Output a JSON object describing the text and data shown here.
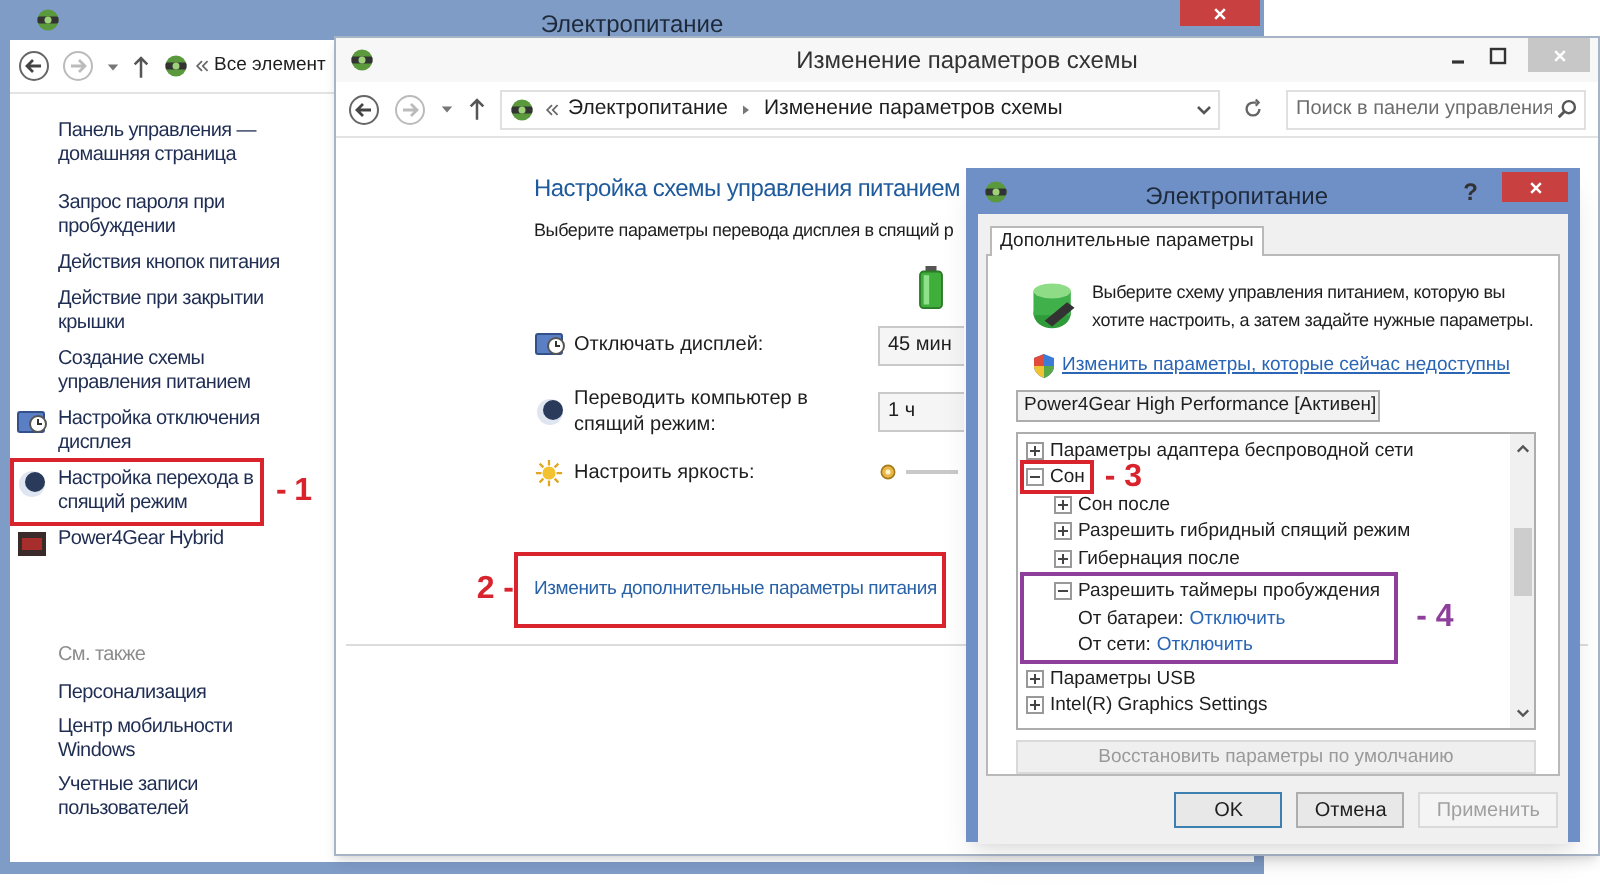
{
  "back_window": {
    "title": "Электропитание",
    "address": "Все элемент",
    "sidebar": {
      "home_link": "Панель управления — домашняя страница",
      "items": [
        {
          "label": "Запрос пароля при пробуждении",
          "kind": "link"
        },
        {
          "label": "Действия кнопок питания",
          "kind": "link"
        },
        {
          "label": "Действие при закрытии крышки",
          "kind": "link"
        },
        {
          "label": "Создание схемы управления питанием",
          "kind": "link"
        },
        {
          "label": "Настройка отключения дисплея",
          "kind": "display"
        },
        {
          "label": "Настройка перехода в спящий режим",
          "kind": "sleep",
          "marker": {
            "label": "- 1",
            "color": "#d9232d",
            "label_before": false
          }
        },
        {
          "label": "Power4Gear Hybrid",
          "kind": "plan"
        }
      ],
      "see_also_heading": "См. также",
      "see_also": [
        "Персонализация",
        "Центр мобильности Windows",
        "Учетные записи пользователей"
      ]
    }
  },
  "scheme_window": {
    "title": "Изменение параметров схемы",
    "breadcrumb": [
      "Электропитание",
      "Изменение параметров схемы"
    ],
    "search": {
      "placeholder": "Поиск в панели управления"
    },
    "heading": "Настройка схемы управления питанием",
    "subtitle": "Выберите параметры перевода дисплея в спящий р",
    "settings": [
      {
        "label": "Отключать дисплей:",
        "kind": "display",
        "value": "45 мин"
      },
      {
        "label": "Переводить компьютер в спящий режим:",
        "kind": "sleep",
        "value": "1 ч"
      },
      {
        "label": "Настроить яркость:",
        "kind": "brightness"
      }
    ],
    "advanced_link": {
      "label": "Изменить дополнительные параметры питания",
      "marker": {
        "label": "2 -",
        "color": "#d9232d",
        "label_before": true
      }
    }
  },
  "dialog": {
    "title": "Электропитание",
    "help": "?",
    "tabs": [
      {
        "label": "Дополнительные параметры",
        "selected": true
      }
    ],
    "intro": "Выберите схему управления питанием, которую вы хотите настроить, а затем задайте нужные параметры.",
    "admin_link": "Изменить параметры, которые сейчас недоступны",
    "plan_select": "Power4Gear High Performance [Активен]",
    "tree": [
      {
        "label": "Параметры адаптера беспроводной сети",
        "kind": "group",
        "expanded": false
      },
      {
        "label": "Сон",
        "kind": "group",
        "expanded": true,
        "marker": {
          "label": "- 3",
          "color": "#d9232d",
          "label_before": false,
          "frames_children": false
        },
        "children": [
          {
            "label": "Сон после",
            "kind": "group",
            "expanded": false
          },
          {
            "label": "Разрешить гибридный спящий режим",
            "kind": "group",
            "expanded": false
          },
          {
            "label": "Гибернация после",
            "kind": "group",
            "expanded": false
          },
          {
            "label": "Разрешить таймеры пробуждения",
            "kind": "group",
            "expanded": true,
            "marker": {
              "label": "- 4",
              "color": "#8e3f9c",
              "label_before": false,
              "frames_children": true
            },
            "children": [
              {
                "label": "От батареи:",
                "kind": "setting",
                "value": "Отключить"
              },
              {
                "label": "От сети:",
                "kind": "setting",
                "value": "Отключить"
              }
            ]
          }
        ]
      },
      {
        "label": "Параметры USB",
        "kind": "group",
        "expanded": false
      },
      {
        "label": "Intel(R) Graphics Settings",
        "kind": "group",
        "expanded": false
      }
    ],
    "restore_button": {
      "label": "Восстановить параметры по умолчанию",
      "disabled": true
    },
    "buttons": [
      {
        "label": "OK",
        "disabled": false,
        "default": true
      },
      {
        "label": "Отмена",
        "disabled": false,
        "default": false
      },
      {
        "label": "Применить",
        "disabled": true,
        "default": false
      }
    ]
  }
}
